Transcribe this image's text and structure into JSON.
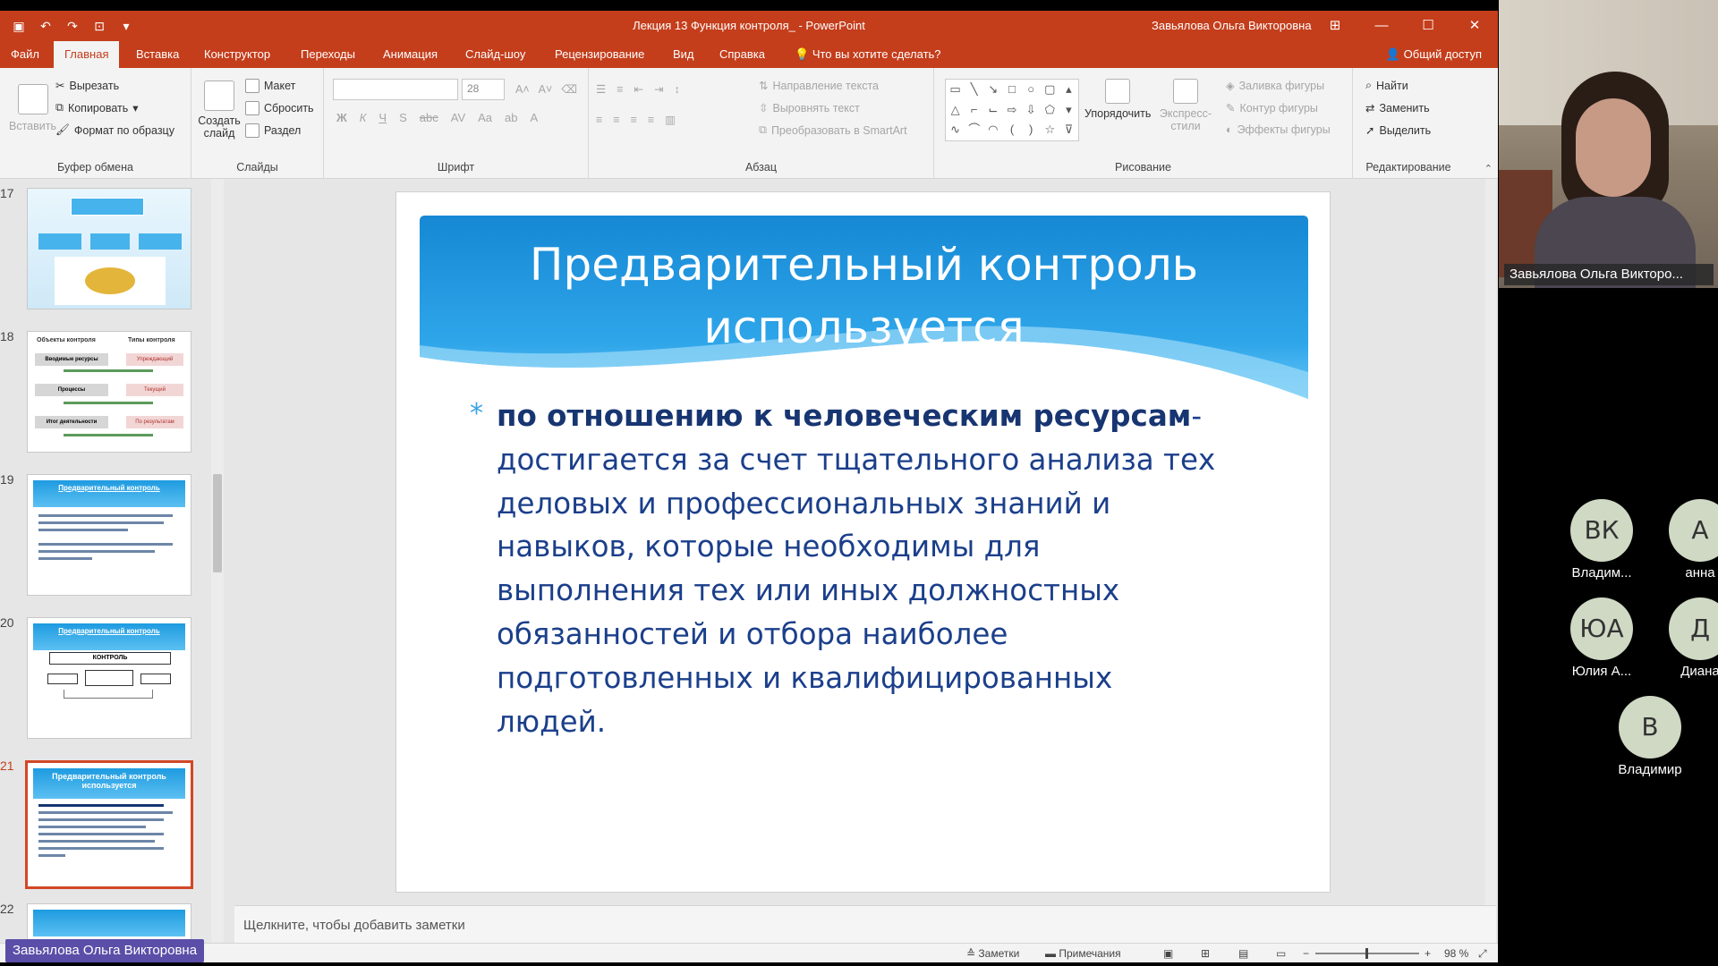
{
  "app": {
    "title": "Лекция 13 Функция контроля_  -  PowerPoint",
    "user": "Завьялова Ольга Викторовна",
    "share": "Общий доступ"
  },
  "tabs": [
    {
      "label": "Файл"
    },
    {
      "label": "Главная"
    },
    {
      "label": "Вставка"
    },
    {
      "label": "Конструктор"
    },
    {
      "label": "Переходы"
    },
    {
      "label": "Анимация"
    },
    {
      "label": "Слайд-шоу"
    },
    {
      "label": "Рецензирование"
    },
    {
      "label": "Вид"
    },
    {
      "label": "Справка"
    },
    {
      "label": "Что вы хотите сделать?"
    }
  ],
  "ribbon": {
    "clipboard": {
      "paste": "Вставить",
      "cut": "Вырезать",
      "copy": "Копировать",
      "format": "Формат по образцу",
      "label": "Буфер обмена"
    },
    "slides": {
      "create": "Создать слайд",
      "layout": "Макет",
      "reset": "Сбросить",
      "section": "Раздел",
      "label": "Слайды"
    },
    "font": {
      "size": "28",
      "label": "Шрифт"
    },
    "paragraph": {
      "direction": "Направление текста",
      "align": "Выровнять текст",
      "smartart": "Преобразовать в SmartArt",
      "label": "Абзац"
    },
    "drawing": {
      "arrange": "Упорядочить",
      "styles": "Экспресс-стили",
      "fill": "Заливка фигуры",
      "outline": "Контур фигуры",
      "effects": "Эффекты фигуры",
      "label": "Рисование"
    },
    "editing": {
      "find": "Найти",
      "replace": "Заменить",
      "select": "Выделить",
      "label": "Редактирование"
    }
  },
  "thumbnails": [
    {
      "num": "17"
    },
    {
      "num": "18",
      "left_head": "Объекты контроля",
      "right_head": "Типы контроля",
      "rows": [
        "Вводимые ресурсы",
        "Процессы",
        "Итог деятельности"
      ],
      "types": [
        "Упреждающий",
        "Текущий",
        "По результатам"
      ]
    },
    {
      "num": "19",
      "title": "Предварительный контроль"
    },
    {
      "num": "20",
      "title": "Предварительный контроль",
      "box": "КОНТРОЛЬ"
    },
    {
      "num": "21",
      "title": "Предварительный контроль используется"
    },
    {
      "num": "22"
    }
  ],
  "slide": {
    "title": "Предварительный контроль используется",
    "bullet": "*",
    "lead": "по отношению к человеческим ресурсам",
    "body": "- достигается за счет тщательного анализа тех деловых и профессиональных знаний и навыков, которые необходимы для выполнения тех или иных должностных обязанностей и отбора наиболее подготовленных и квалифицированных людей."
  },
  "notes_placeholder": "Щелкните, чтобы добавить заметки",
  "status": {
    "notes": "Заметки",
    "comments": "Примечания",
    "zoom": "98 %"
  },
  "presenter_tag": "Завьялова Ольга Викторовна",
  "conference": {
    "camera_label": "Завьялова Ольга Викторо...",
    "participants": [
      {
        "initials": "ВК",
        "name": "Владим..."
      },
      {
        "initials": "А",
        "name": "анна"
      },
      {
        "initials": "ЮА",
        "name": "Юлия А..."
      },
      {
        "initials": "Д",
        "name": "Диана"
      },
      {
        "initials": "В",
        "name": "Владимир"
      }
    ]
  },
  "colors": {
    "accent": "#c43e1c",
    "slide_blue": "#1e9be0",
    "text_blue": "#1b3f8b"
  }
}
